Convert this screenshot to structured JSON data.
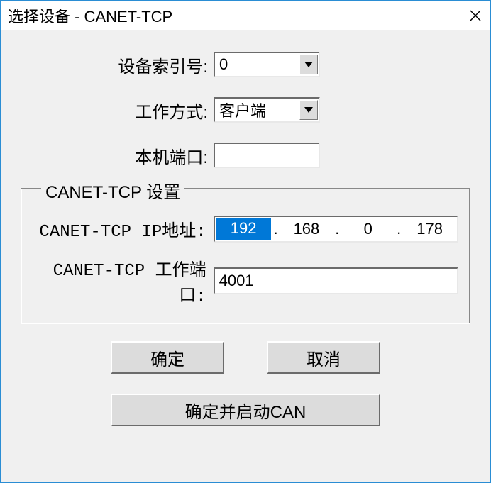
{
  "title": "选择设备 - CANET-TCP",
  "labels": {
    "device_index": "设备索引号:",
    "work_mode": "工作方式:",
    "local_port": "本机端口:"
  },
  "device_index": {
    "value": "0"
  },
  "work_mode": {
    "value": "客户端"
  },
  "local_port": {
    "value": ""
  },
  "group": {
    "title": "CANET-TCP 设置",
    "ip_label": "CANET-TCP IP地址:",
    "port_label": "CANET-TCP 工作端口:",
    "ip": {
      "a": "192",
      "b": "168",
      "c": "0",
      "d": "178"
    },
    "port": "4001"
  },
  "buttons": {
    "ok": "确定",
    "cancel": "取消",
    "ok_start_can": "确定并启动CAN"
  }
}
